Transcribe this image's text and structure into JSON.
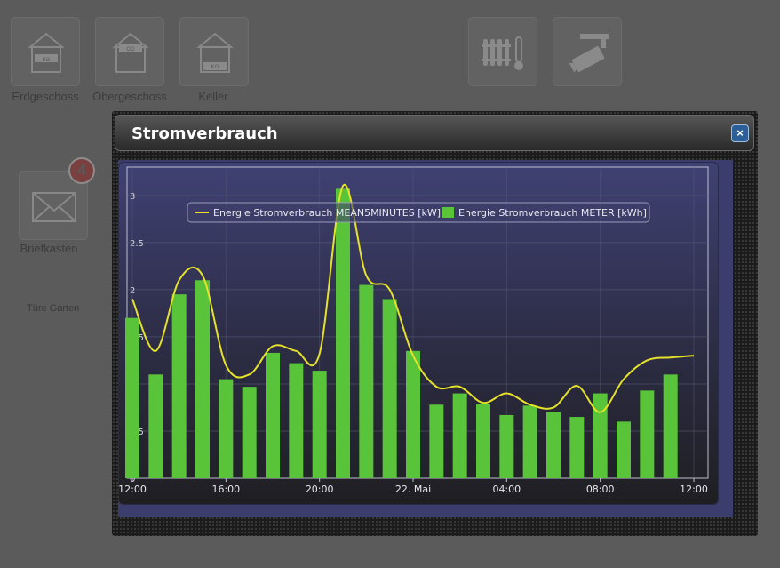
{
  "tiles": {
    "erdgeschoss": {
      "label": "Erdgeschoss",
      "sign": "EG"
    },
    "obergeschoss": {
      "label": "Obergeschoss",
      "sign": "OG"
    },
    "keller": {
      "label": "Keller",
      "sign": "KG"
    },
    "briefkasten": {
      "label": "Briefkasten",
      "badge": "4"
    },
    "tuere_garten": {
      "label": "Türe Garten"
    },
    "heizung": {
      "icon": "radiator-icon"
    },
    "kamera": {
      "icon": "camera-icon"
    }
  },
  "popup": {
    "title": "Stromverbrauch",
    "close_label": "×"
  },
  "chart_data": {
    "type": "bar",
    "title": "",
    "xlabel": "",
    "ylabel": "",
    "x_ticks": [
      "12:00",
      "16:00",
      "20:00",
      "22. Mai",
      "04:00",
      "08:00",
      "12:00"
    ],
    "y_ticks": [
      "0",
      "0.5",
      "1",
      "1.5",
      "2",
      "2.5",
      "3"
    ],
    "ylim": [
      0,
      3.3
    ],
    "x_range_hours": [
      0,
      24
    ],
    "grid": true,
    "legend_position": "top-center",
    "series": [
      {
        "name": "Energie Stromverbrauch METER [kWh]",
        "type": "bar",
        "color": "#59c43a",
        "x": [
          0,
          1,
          2,
          3,
          4,
          5,
          6,
          7,
          8,
          9,
          10,
          11,
          12,
          13,
          14,
          15,
          16,
          17,
          18,
          19,
          20,
          21,
          22,
          23
        ],
        "values": [
          1.7,
          1.1,
          1.95,
          2.1,
          1.05,
          0.97,
          1.33,
          1.22,
          1.14,
          3.07,
          2.05,
          1.9,
          1.35,
          0.78,
          0.9,
          0.79,
          0.67,
          0.77,
          0.7,
          0.65,
          0.9,
          0.6,
          0.93,
          1.1
        ]
      },
      {
        "name": "Energie Stromverbrauch MEAN5MINUTES [kW]",
        "type": "line",
        "color": "#e6e22a",
        "x": [
          0,
          1,
          2,
          3,
          4,
          5,
          6,
          7,
          8,
          9,
          10,
          11,
          12,
          13,
          14,
          15,
          16,
          17,
          18,
          19,
          20,
          21,
          22,
          23,
          24
        ],
        "values": [
          1.9,
          1.35,
          2.1,
          2.15,
          1.2,
          1.1,
          1.4,
          1.35,
          1.32,
          3.1,
          2.15,
          2.0,
          1.3,
          0.97,
          0.97,
          0.8,
          0.9,
          0.78,
          0.75,
          0.98,
          0.7,
          1.05,
          1.25,
          1.28,
          1.3
        ]
      }
    ]
  }
}
